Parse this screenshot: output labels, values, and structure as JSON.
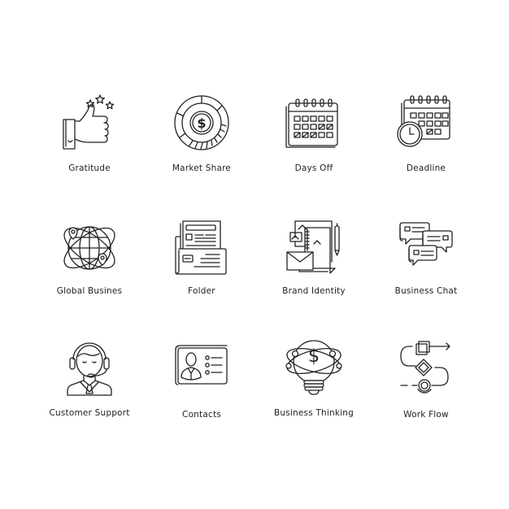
{
  "icons": [
    {
      "name": "gratitude",
      "icon": "thumbs-up-stars-icon",
      "label": "Gratitude"
    },
    {
      "name": "market-share",
      "icon": "pie-dollar-icon",
      "label": "Market Share"
    },
    {
      "name": "days-off",
      "icon": "calendar-icon",
      "label": "Days Off"
    },
    {
      "name": "deadline",
      "icon": "calendar-clock-icon",
      "label": "Deadline"
    },
    {
      "name": "global-business",
      "icon": "globe-orbit-icon",
      "label": "Global Busines"
    },
    {
      "name": "folder",
      "icon": "folder-documents-icon",
      "label": "Folder"
    },
    {
      "name": "brand-identity",
      "icon": "brand-stationery-icon",
      "label": "Brand Identity"
    },
    {
      "name": "business-chat",
      "icon": "chat-bubbles-icon",
      "label": "Business Chat"
    },
    {
      "name": "customer-support",
      "icon": "headset-agent-icon",
      "label": "Customer Support"
    },
    {
      "name": "contacts",
      "icon": "contact-card-icon",
      "label": "Contacts"
    },
    {
      "name": "business-thinking",
      "icon": "lightbulb-dollar-icon",
      "label": "Business Thinking"
    },
    {
      "name": "work-flow",
      "icon": "workflow-icon",
      "label": "Work Flow"
    }
  ],
  "currency_symbol": "$"
}
